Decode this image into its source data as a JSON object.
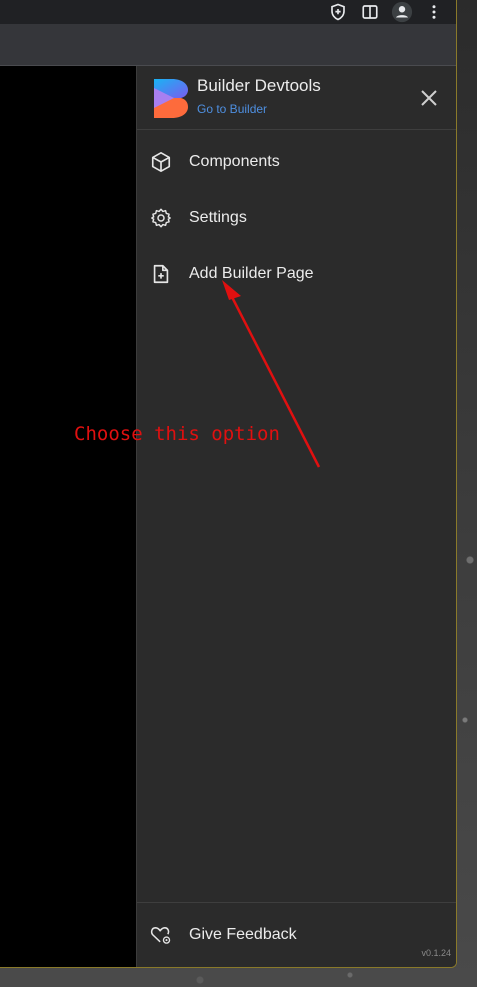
{
  "panel": {
    "title": "Builder Devtools",
    "link": "Go to Builder",
    "close_icon": "close-icon",
    "items": [
      {
        "label": "Components",
        "icon": "cube-icon"
      },
      {
        "label": "Settings",
        "icon": "gear-icon"
      },
      {
        "label": "Add Builder Page",
        "icon": "file-plus-icon"
      }
    ],
    "footer": {
      "label": "Give Feedback",
      "icon": "heart-gear-icon"
    },
    "version": "v0.1.24"
  },
  "toolbar": {
    "icons": [
      "shield-plus-icon",
      "split-view-icon",
      "profile-icon",
      "more-vert-icon"
    ]
  },
  "annotation": {
    "text": "Choose this option",
    "color": "#e01010"
  },
  "colors": {
    "panel_bg": "#2b2b2b",
    "link": "#4e8fe0",
    "text": "#ececec"
  }
}
